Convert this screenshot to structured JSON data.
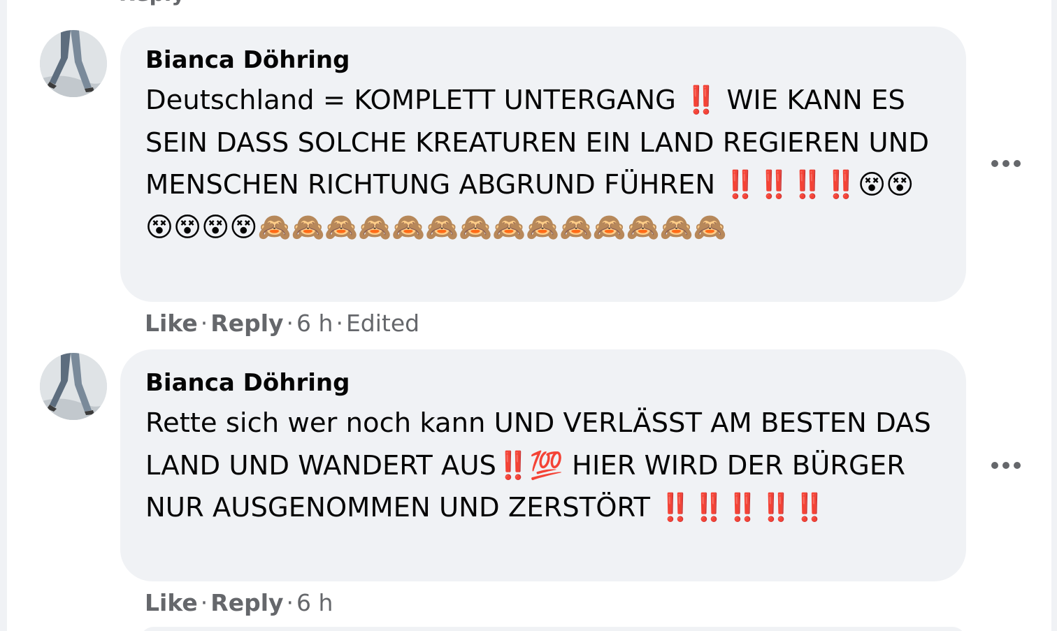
{
  "page": {
    "top_cut_text": "Reply"
  },
  "comments": [
    {
      "author": "Bianca Döhring",
      "text": "Deutschland = KOMPLETT UNTERGANG ‼️ WIE KANN ES SEIN DASS SOLCHE KREATUREN EIN LAND REGIEREN UND MENSCHEN RICHTUNG ABGRUND FÜHREN ‼️‼️‼️‼️😵😵😵😵😵😵🙈🙈🙈🙈🙈🙈🙈🙈🙈🙈🙈🙈🙈🙈",
      "like_label": "Like",
      "reply_label": "Reply",
      "time": "6 h",
      "edited": "Edited"
    },
    {
      "author": "Bianca Döhring",
      "text": "Rette sich wer noch kann UND VERLÄSST AM BESTEN DAS LAND UND WANDERT AUS‼️💯 HIER WIRD DER BÜRGER NUR AUSGENOMMEN UND ZERSTÖRT ‼️‼️‼️‼️‼️",
      "like_label": "Like",
      "reply_label": "Reply",
      "time": "6 h"
    }
  ],
  "icons": {
    "more": "more-options-icon",
    "avatar": "avatar"
  },
  "colors": {
    "bubble_bg": "#f0f2f5",
    "text": "#050505",
    "meta": "#65676b"
  }
}
